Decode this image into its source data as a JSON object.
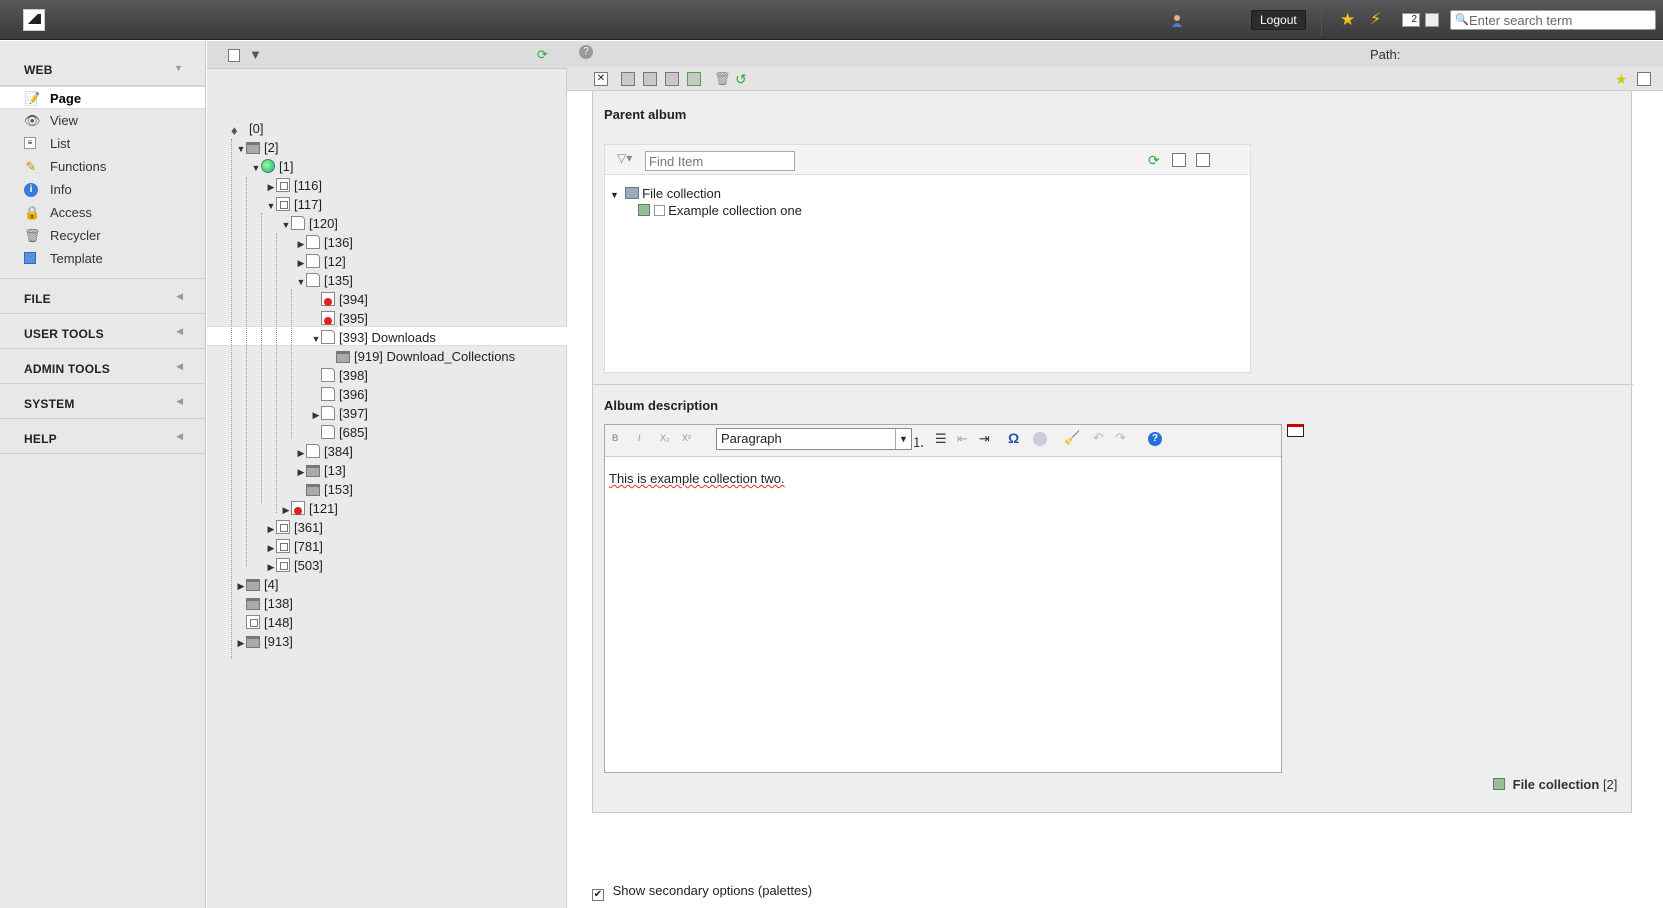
{
  "topbar": {
    "logout_label": "Logout",
    "open_docs_count": "2",
    "search_placeholder": "Enter search term"
  },
  "modules": {
    "groups": [
      {
        "title": "WEB"
      },
      {
        "title": "FILE"
      },
      {
        "title": "USER TOOLS"
      },
      {
        "title": "ADMIN TOOLS"
      },
      {
        "title": "SYSTEM"
      },
      {
        "title": "HELP"
      }
    ],
    "web_items": [
      {
        "label": "Page",
        "icon": "page-edit-icon"
      },
      {
        "label": "View",
        "icon": "eye-icon"
      },
      {
        "label": "List",
        "icon": "list-icon"
      },
      {
        "label": "Functions",
        "icon": "wand-icon"
      },
      {
        "label": "Info",
        "icon": "info-icon"
      },
      {
        "label": "Access",
        "icon": "lock-icon"
      },
      {
        "label": "Recycler",
        "icon": "trash-icon"
      },
      {
        "label": "Template",
        "icon": "template-icon"
      }
    ]
  },
  "tree": {
    "nodes": [
      {
        "label": "[0]",
        "expander": "",
        "icon": "root"
      },
      {
        "label": "[2]",
        "expander": "▼",
        "icon": "folder"
      },
      {
        "label": "[1]",
        "expander": "▼",
        "icon": "globe"
      },
      {
        "label": "[116]",
        "expander": "▶",
        "icon": "shortcut"
      },
      {
        "label": "[117]",
        "expander": "▼",
        "icon": "shortcut"
      },
      {
        "label": "[120]",
        "expander": "▼",
        "icon": "page"
      },
      {
        "label": "[136]",
        "expander": "▶",
        "icon": "page"
      },
      {
        "label": "[12]",
        "expander": "▶",
        "icon": "page"
      },
      {
        "label": "[135]",
        "expander": "▼",
        "icon": "page"
      },
      {
        "label": "[394]",
        "expander": "",
        "icon": "red"
      },
      {
        "label": "[395]",
        "expander": "",
        "icon": "red"
      },
      {
        "label": "[393] Downloads",
        "expander": "▼",
        "icon": "page"
      },
      {
        "label": "[919] Download_Collections",
        "expander": "",
        "icon": "folder"
      },
      {
        "label": "[398]",
        "expander": "",
        "icon": "page"
      },
      {
        "label": "[396]",
        "expander": "",
        "icon": "page"
      },
      {
        "label": "[397]",
        "expander": "▶",
        "icon": "page"
      },
      {
        "label": "[685]",
        "expander": "",
        "icon": "page"
      },
      {
        "label": "[384]",
        "expander": "▶",
        "icon": "page"
      },
      {
        "label": "[13]",
        "expander": "▶",
        "icon": "folder"
      },
      {
        "label": "[153]",
        "expander": "",
        "icon": "folder"
      },
      {
        "label": "[121]",
        "expander": "▶",
        "icon": "red"
      },
      {
        "label": "[361]",
        "expander": "▶",
        "icon": "shortcut"
      },
      {
        "label": "[781]",
        "expander": "▶",
        "icon": "shortcut"
      },
      {
        "label": "[503]",
        "expander": "▶",
        "icon": "shortcut"
      },
      {
        "label": "[4]",
        "expander": "▶",
        "icon": "folder"
      },
      {
        "label": "[138]",
        "expander": "",
        "icon": "folder"
      },
      {
        "label": "[148]",
        "expander": "",
        "icon": "shortcut"
      },
      {
        "label": "[913]",
        "expander": "▶",
        "icon": "folder"
      }
    ]
  },
  "doc": {
    "path_label": "Path:"
  },
  "form": {
    "parent_album_title": "Parent album",
    "find_placeholder": "Find Item",
    "album_tree": {
      "root_label": "File collection",
      "child_label": "Example collection one"
    },
    "album_description_title": "Album description",
    "rte": {
      "block_format": "Paragraph",
      "buttons": [
        "B",
        "I",
        "X₂",
        "X²"
      ],
      "content": "This is example collection two."
    },
    "footer": {
      "collection_label": "File collection",
      "collection_id": "[2]"
    },
    "secondary_options_label": "Show secondary options (palettes)"
  }
}
